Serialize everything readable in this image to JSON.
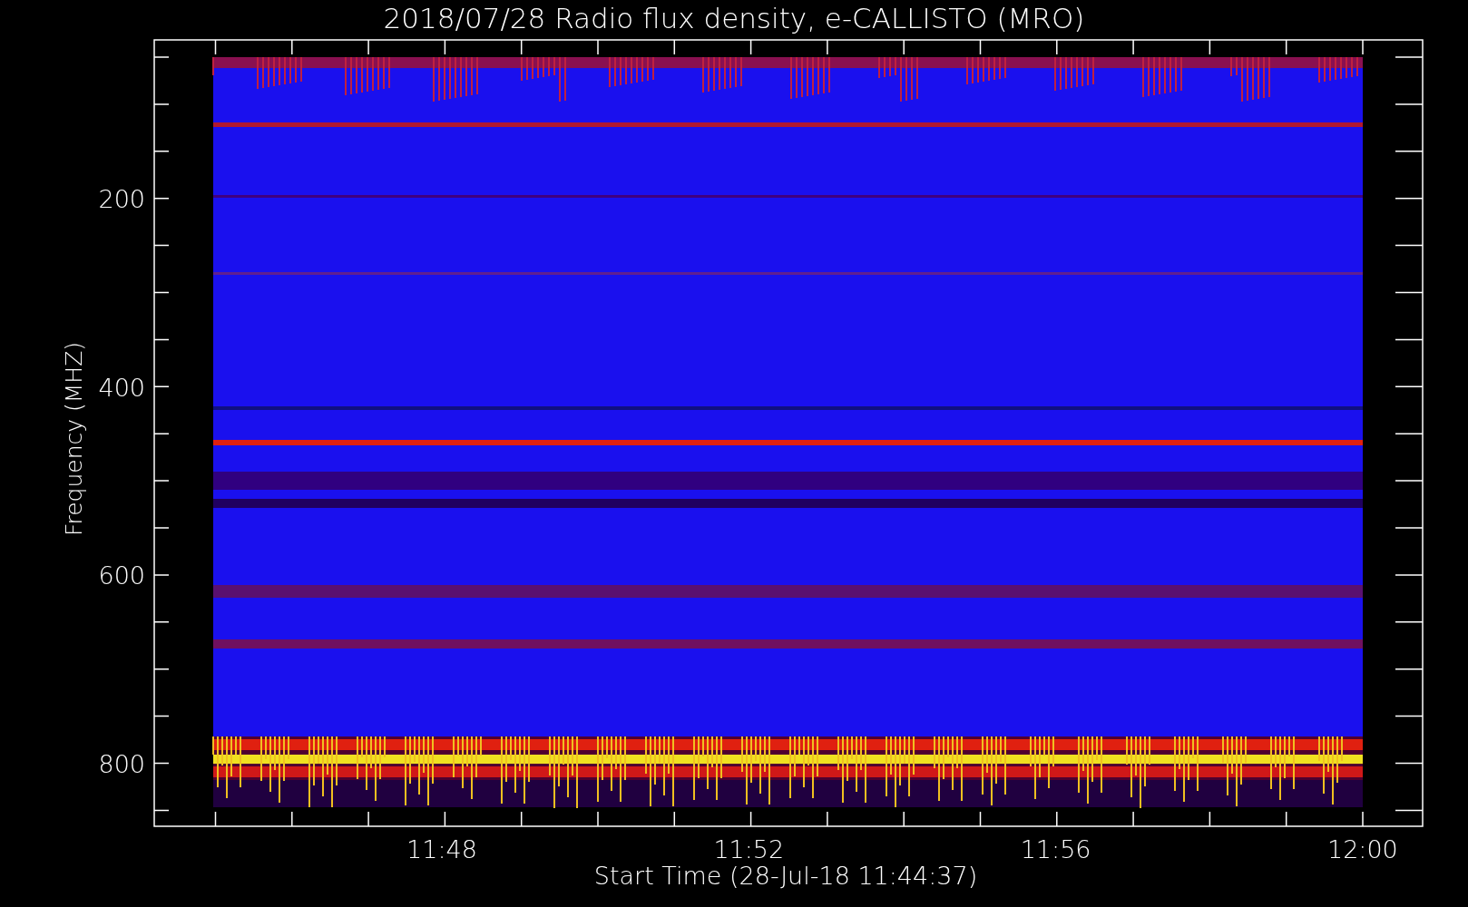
{
  "title": "2018/07/28  Radio flux density, e-CALLISTO (MRO)",
  "y_axis": {
    "label": "Frequency (MHZ)",
    "ticks": [
      "200",
      "400",
      "600",
      "800"
    ]
  },
  "x_axis": {
    "label": "Start Time (28-Jul-18 11:44:37)",
    "ticks": [
      "11:48",
      "11:52",
      "11:56",
      "12:00"
    ]
  }
}
